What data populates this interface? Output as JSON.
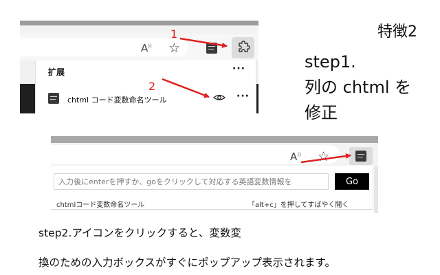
{
  "slide": {
    "feature_title": "特徴2",
    "step1_lines": [
      "step1.",
      "列の chtml を",
      "修正"
    ],
    "step2_lines": [
      "step2.アイコンをクリックすると、変数変",
      "換のための入力ボックスがすぐにポップアップ表示されます。"
    ]
  },
  "screenshot1": {
    "toolbar_icons": [
      "read-aloud-icon",
      "favorite-star-icon",
      "extension-icon",
      "puzzle-icon"
    ],
    "read_aloud_glyph": "A",
    "read_aloud_sup": "))",
    "star_glyph": "☆",
    "panel": {
      "title": "扩展",
      "more_glyph": "···",
      "extension_name": "chtml コード変数命名ツール",
      "item_more_glyph": "···"
    }
  },
  "screenshot2": {
    "read_aloud_glyph": "A",
    "read_aloud_sup": "))",
    "star_glyph": "☆",
    "input_placeholder": "入力後にenterを押すか、goをクリックして対応する英語変数情報を",
    "go_label": "Go",
    "extension_name": "chtmlコード変数命名ツール",
    "shortcut_hint": "「alt+c」を押してすばやく開く"
  },
  "annotations": {
    "marker_1": "1",
    "marker_2": "2",
    "arrow_color": "#e02020"
  }
}
